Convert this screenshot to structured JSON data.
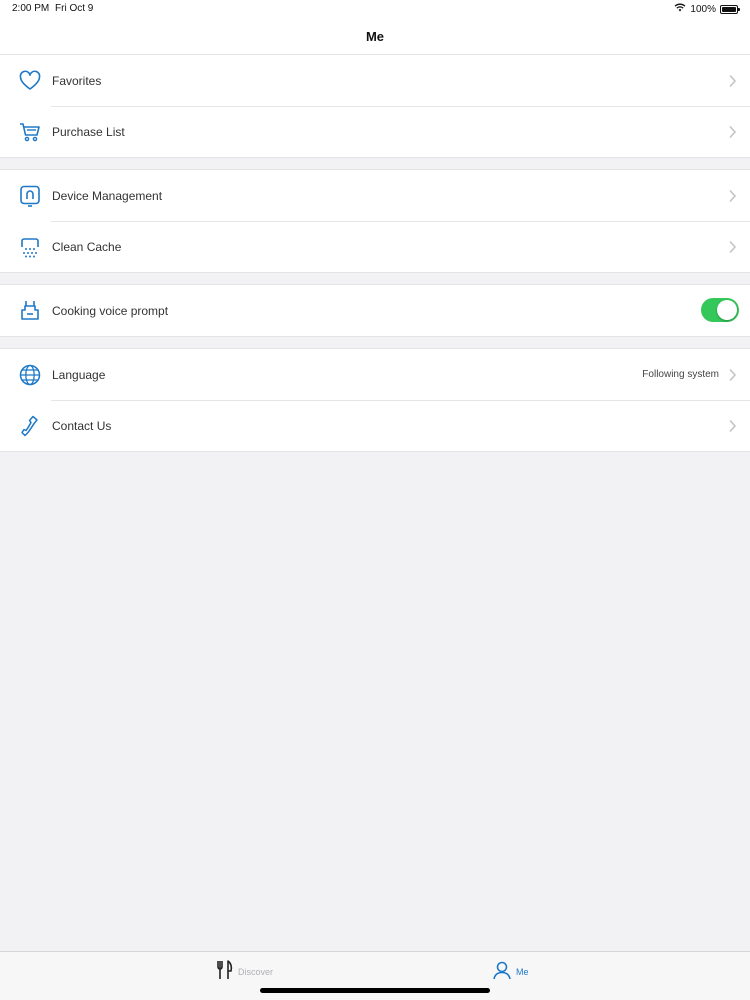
{
  "status_bar": {
    "time": "2:00 PM",
    "date": "Fri Oct 9",
    "battery": "100%",
    "icons": [
      "wifi-icon",
      "battery-icon"
    ]
  },
  "nav": {
    "title": "Me"
  },
  "groups": [
    {
      "items": [
        {
          "label": "Favorites",
          "icon": "heart-icon"
        },
        {
          "label": "Purchase List",
          "icon": "cart-icon"
        }
      ]
    },
    {
      "items": [
        {
          "label": "Device Management",
          "icon": "device-icon"
        },
        {
          "label": "Clean Cache",
          "icon": "clean-cache-icon"
        }
      ]
    },
    {
      "items": [
        {
          "label": "Cooking voice prompt",
          "icon": "apron-icon",
          "toggle_on": true
        }
      ]
    },
    {
      "items": [
        {
          "label": "Language",
          "icon": "globe-icon",
          "value": "Following system"
        },
        {
          "label": "Contact Us",
          "icon": "phone-icon"
        }
      ]
    }
  ],
  "tab_bar": {
    "tabs": [
      {
        "label": "Discover",
        "icon": "utensils-icon",
        "active": false
      },
      {
        "label": "Me",
        "icon": "person-icon",
        "active": true
      }
    ]
  },
  "colors": {
    "accent": "#1e78c8",
    "toggle_on": "#34c759",
    "background": "#f2f2f4",
    "inactive_tab": "#b0b0b4"
  }
}
